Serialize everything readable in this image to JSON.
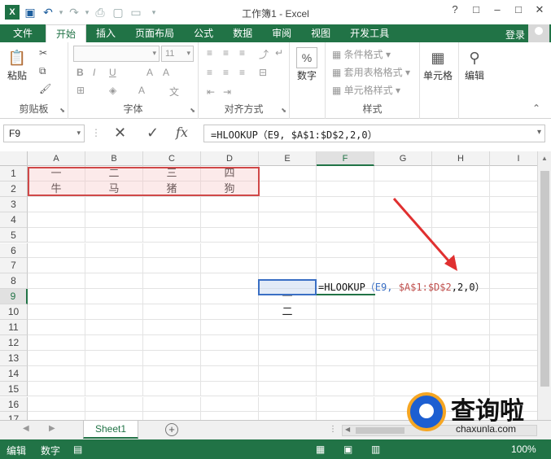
{
  "window": {
    "title": "工作簿1 - Excel",
    "controls": [
      "?",
      "□",
      "–",
      "□",
      "✕"
    ]
  },
  "ribbon_tabs": [
    {
      "label": "文件",
      "active": false
    },
    {
      "label": "开始",
      "active": true
    },
    {
      "label": "插入",
      "active": false
    },
    {
      "label": "页面布局",
      "active": false
    },
    {
      "label": "公式",
      "active": false
    },
    {
      "label": "数据",
      "active": false
    },
    {
      "label": "审阅",
      "active": false
    },
    {
      "label": "视图",
      "active": false
    },
    {
      "label": "开发工具",
      "active": false
    }
  ],
  "account": {
    "login_label": "登录"
  },
  "ribbon": {
    "clipboard": {
      "label": "剪贴板",
      "paste": "粘贴"
    },
    "font": {
      "label": "字体",
      "size": "11"
    },
    "alignment": {
      "label": "对齐方式"
    },
    "number": {
      "label": "数字",
      "button": "数字",
      "symbol": "%"
    },
    "styles": {
      "label": "样式",
      "conditional": "条件格式",
      "table": "套用表格格式",
      "cell_styles": "单元格样式"
    },
    "cells": {
      "button": "单元格"
    },
    "editing": {
      "button": "编辑"
    }
  },
  "formula_bar": {
    "name_box": "F9",
    "formula": "=HLOOKUP（E9, $A$1:$D$2,2,0）"
  },
  "columns": [
    "A",
    "B",
    "C",
    "D",
    "E",
    "F",
    "G",
    "H",
    "I"
  ],
  "rows": [
    "1",
    "2",
    "3",
    "4",
    "5",
    "6",
    "7",
    "8",
    "9",
    "10",
    "11",
    "12",
    "13",
    "14",
    "15",
    "16",
    "17"
  ],
  "cells": {
    "A1": "一",
    "B1": "二",
    "C1": "三",
    "D1": "四",
    "A2": "牛",
    "B2": "马",
    "C2": "猪",
    "D2": "狗",
    "E9": "一",
    "E10": "二"
  },
  "formula_in_cell": {
    "part1": "=HLOOKUP",
    "part2": "（E9, ",
    "part3": "$A$1:$D$2",
    "part4": ",2,0）"
  },
  "sheets": [
    {
      "name": "Sheet1",
      "active": true
    }
  ],
  "status": {
    "mode": "编辑",
    "number_mode": "数字",
    "zoom": "100%"
  },
  "watermark": {
    "text": "查询啦",
    "url": "chaxunla.com"
  },
  "colors": {
    "excel_green": "#217346",
    "range_red": "#d04848",
    "ref_blue": "#3a6fc4"
  }
}
